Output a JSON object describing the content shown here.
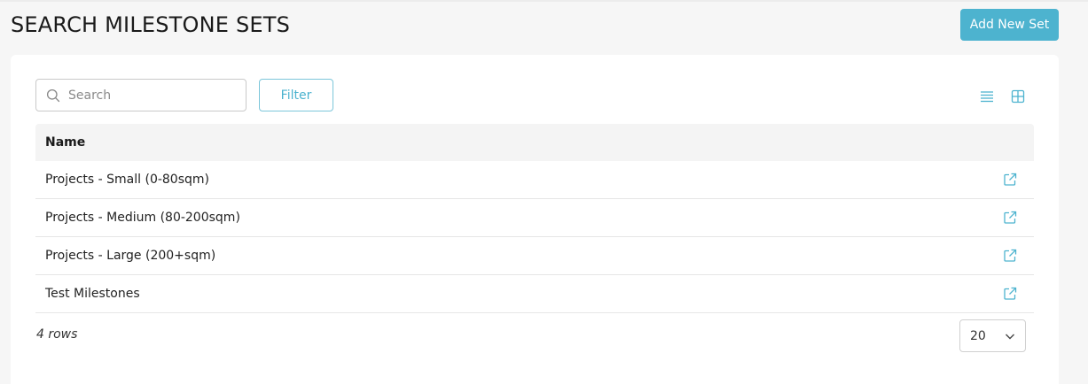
{
  "header": {
    "title": "SEARCH MILESTONE SETS",
    "add_button_label": "Add New Set"
  },
  "toolbar": {
    "search_placeholder": "Search",
    "search_value": "",
    "filter_label": "Filter",
    "view_icons": [
      "list-view-icon",
      "grid-view-icon"
    ]
  },
  "table": {
    "columns": [
      "Name"
    ],
    "rows": [
      {
        "name": "Projects - Small (0-80sqm)",
        "action_icon": "open-external-icon"
      },
      {
        "name": "Projects - Medium (80-200sqm)",
        "action_icon": "open-external-icon"
      },
      {
        "name": "Projects - Large (200+sqm)",
        "action_icon": "open-external-icon"
      },
      {
        "name": "Test Milestones",
        "action_icon": "open-external-icon"
      }
    ]
  },
  "footer": {
    "row_count": "4 rows",
    "page_size": "20"
  },
  "colors": {
    "accent": "#4db3cf",
    "header_bg": "#f4f4f4",
    "page_bg": "#f6f6f6"
  }
}
